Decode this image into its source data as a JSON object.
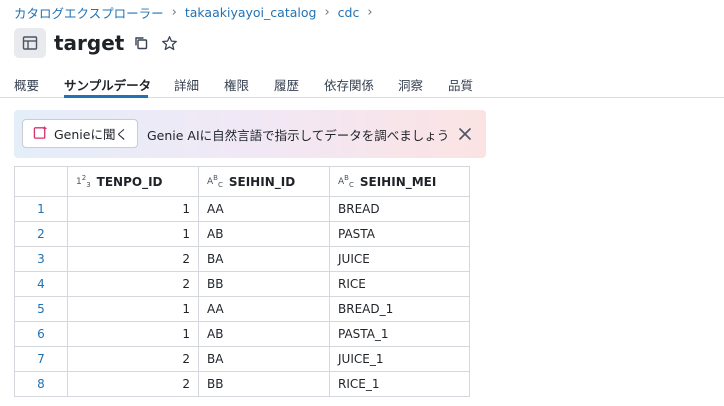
{
  "breadcrumb": {
    "items": [
      "カタログエクスプローラー",
      "takaakiyayoi_catalog",
      "cdc"
    ],
    "separator": "›"
  },
  "header": {
    "title": "target"
  },
  "tabs": [
    {
      "label": "概要",
      "active": false
    },
    {
      "label": "サンプルデータ",
      "active": true
    },
    {
      "label": "詳細",
      "active": false
    },
    {
      "label": "権限",
      "active": false
    },
    {
      "label": "履歴",
      "active": false
    },
    {
      "label": "依存関係",
      "active": false
    },
    {
      "label": "洞察",
      "active": false
    },
    {
      "label": "品質",
      "active": false
    }
  ],
  "genie": {
    "button_label": "Genieに聞く",
    "prompt_text": "Genie AIに自然言語で指示してデータを調べましょう"
  },
  "table": {
    "columns": [
      {
        "name": "TENPO_ID",
        "type_icon": "numeric-type-icon"
      },
      {
        "name": "SEIHIN_ID",
        "type_icon": "string-type-icon"
      },
      {
        "name": "SEIHIN_MEI",
        "type_icon": "string-type-icon"
      }
    ],
    "rows": [
      {
        "idx": "1",
        "tenpo_id": "1",
        "seihin_id": "AA",
        "seihin_mei": "BREAD"
      },
      {
        "idx": "2",
        "tenpo_id": "1",
        "seihin_id": "AB",
        "seihin_mei": "PASTA"
      },
      {
        "idx": "3",
        "tenpo_id": "2",
        "seihin_id": "BA",
        "seihin_mei": "JUICE"
      },
      {
        "idx": "4",
        "tenpo_id": "2",
        "seihin_id": "BB",
        "seihin_mei": "RICE"
      },
      {
        "idx": "5",
        "tenpo_id": "1",
        "seihin_id": "AA",
        "seihin_mei": "BREAD_1"
      },
      {
        "idx": "6",
        "tenpo_id": "1",
        "seihin_id": "AB",
        "seihin_mei": "PASTA_1"
      },
      {
        "idx": "7",
        "tenpo_id": "2",
        "seihin_id": "BA",
        "seihin_mei": "JUICE_1"
      },
      {
        "idx": "8",
        "tenpo_id": "2",
        "seihin_id": "BB",
        "seihin_mei": "RICE_1"
      }
    ]
  },
  "colors": {
    "accent": "#2272b4",
    "genie_gradient_start": "#e4eef8",
    "genie_gradient_end": "#fbe3e3",
    "genie_icon": "#d6336c"
  }
}
